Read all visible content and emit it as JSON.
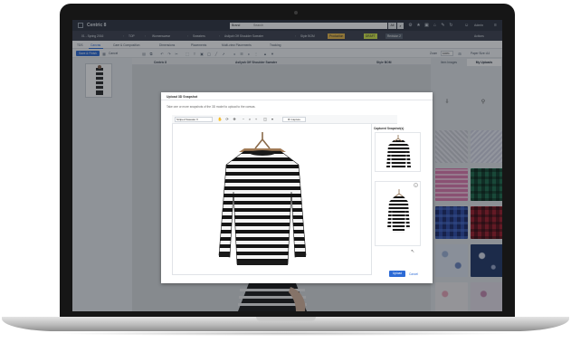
{
  "app": {
    "title": "Centric 8",
    "user": "Admin"
  },
  "search": {
    "scope": "Brand",
    "placeholder": "Search",
    "all_label": "All"
  },
  "breadcrumb": {
    "items": [
      "01 - Spring 2016",
      "TOP",
      "Womenswear",
      "Sweaters",
      "Asilyah Off Shoulder Sweater",
      "Style BOM"
    ],
    "production_label": "Production",
    "draft_label": "DRAFT",
    "revision_label": "Revision 2",
    "actions_label": "Actions"
  },
  "tabs": [
    "TDS",
    "Canvas",
    "Care & Composition",
    "Dimensions",
    "Placements",
    "Multi-view Placements",
    "Tracking"
  ],
  "toolbar": {
    "save_label": "Save & Finish",
    "cancel_label": "Cancel",
    "zoom_label": "Zoom",
    "zoom_value": "100%",
    "paper_label": "Paper Size: A4"
  },
  "columns": {
    "a": "Centric 8",
    "b": "Asilyah Off Shoulder Sweater",
    "c": "Style BOM"
  },
  "right_panel": {
    "tab_item": "Item Images",
    "tab_uploads": "My Uploads"
  },
  "modal": {
    "title": "Upload 3D Snapshot",
    "description": "Take one or more snapshots of the 3D model to upload to the canvas.",
    "model_select": "Striped Sweater",
    "capture_label": "Capture",
    "snapshots_title": "Captured Snapshot(s)",
    "upload_label": "Upload",
    "cancel_label": "Cancel"
  },
  "colors": {
    "accent": "#2d6bd6",
    "topbar": "#2f3440",
    "draft": "#d4e84a",
    "production": "#e8b94a"
  }
}
